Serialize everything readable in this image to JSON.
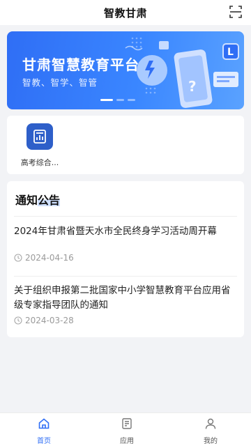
{
  "header": {
    "title": "智教甘肃",
    "scan_icon": "scan-icon"
  },
  "banner": {
    "title": "甘肃智慧教育平台",
    "subtitle": "智教、智学、智管",
    "active_slide": 1,
    "slide_count": 3
  },
  "apps": [
    {
      "label": "高考综合...",
      "icon": "report-chart-icon"
    }
  ],
  "notices": {
    "heading_plain": "通知",
    "heading_highlight": "公告",
    "items": [
      {
        "title": "2024年甘肃省暨天水市全民终身学习活动周开幕",
        "date": "2024-04-16"
      },
      {
        "title": "关于组织申报第二批国家中小学智慧教育平台应用省级专家指导团队的通知",
        "date": "2024-03-28"
      }
    ]
  },
  "tabbar": {
    "items": [
      {
        "label": "首页",
        "icon": "home-icon",
        "active": true
      },
      {
        "label": "应用",
        "icon": "apps-icon",
        "active": false
      },
      {
        "label": "我的",
        "icon": "user-icon",
        "active": false
      }
    ]
  },
  "colors": {
    "accent": "#2f6ef5",
    "app_icon_bg": "#2e5fc9",
    "page_bg": "#f2f3f6"
  }
}
